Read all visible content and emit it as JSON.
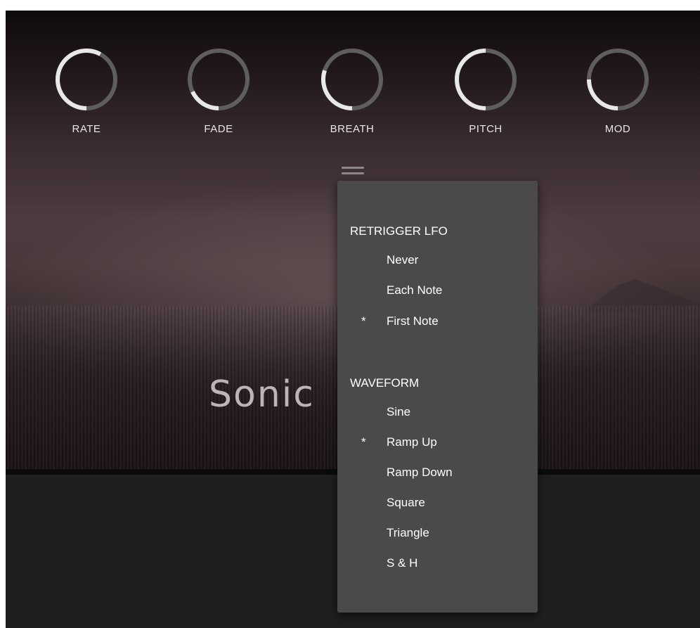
{
  "knobs": [
    {
      "label": "RATE",
      "value": 0.58
    },
    {
      "label": "FADE",
      "value": 0.18
    },
    {
      "label": "BREATH",
      "value": 0.3
    },
    {
      "label": "PITCH",
      "value": 0.5
    },
    {
      "label": "MOD",
      "value": 0.25
    }
  ],
  "logo": {
    "text": "Sonic"
  },
  "menu": {
    "icon": "hamburger-menu-icon",
    "sections": [
      {
        "title": "RETRIGGER LFO",
        "items": [
          {
            "label": "Never",
            "mark": ""
          },
          {
            "label": "Each Note",
            "mark": ""
          },
          {
            "label": "First Note",
            "mark": "*"
          }
        ]
      },
      {
        "title": "WAVEFORM",
        "items": [
          {
            "label": "Sine",
            "mark": ""
          },
          {
            "label": "Ramp Up",
            "mark": "*"
          },
          {
            "label": "Ramp Down",
            "mark": ""
          },
          {
            "label": "Square",
            "mark": ""
          },
          {
            "label": "Triangle",
            "mark": ""
          },
          {
            "label": "S & H",
            "mark": ""
          }
        ]
      }
    ]
  },
  "colors": {
    "knob_arc_active": "#e8e8e8",
    "knob_arc_track": "#5e5e5e",
    "popup_bg": "#4a4a4a",
    "panel_bg": "#1f1f1f"
  }
}
